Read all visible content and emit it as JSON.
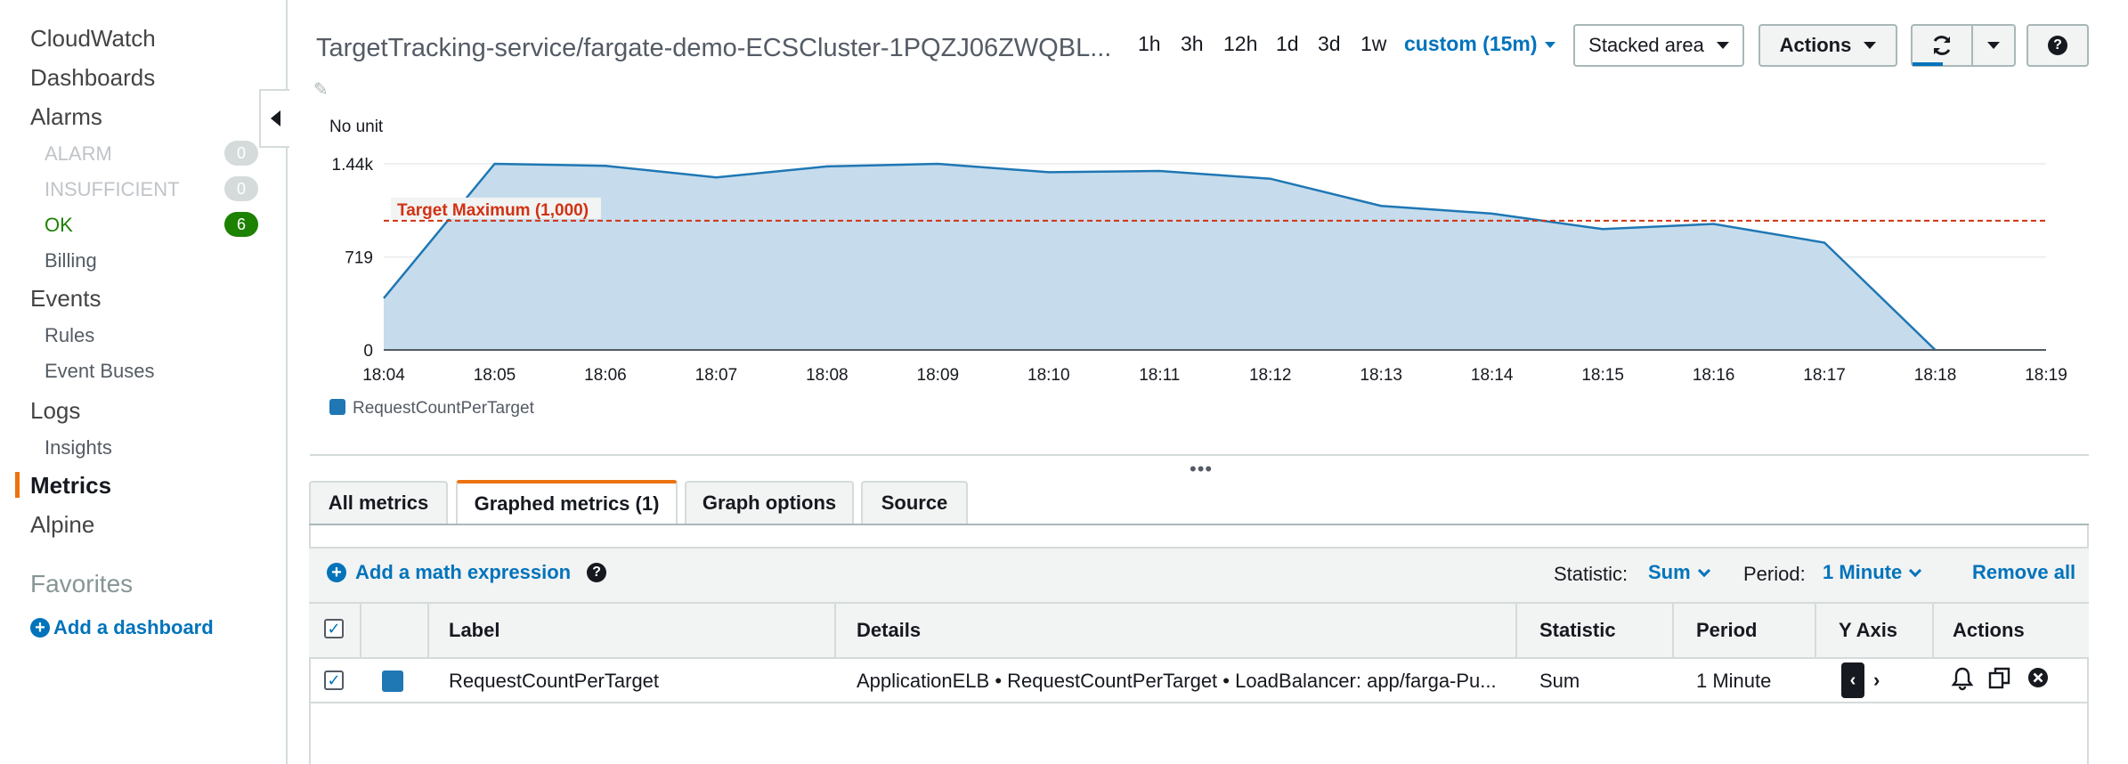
{
  "sidebar": {
    "cloudwatch": "CloudWatch",
    "dashboards": "Dashboards",
    "alarms": "Alarms",
    "alarm_states": [
      {
        "label": "ALARM",
        "count": "0"
      },
      {
        "label": "INSUFFICIENT",
        "count": "0"
      },
      {
        "label": "OK",
        "count": "6"
      }
    ],
    "billing": "Billing",
    "events": "Events",
    "rules": "Rules",
    "event_buses": "Event Buses",
    "logs": "Logs",
    "insights": "Insights",
    "metrics": "Metrics",
    "alpine": "Alpine",
    "favorites": "Favorites",
    "add_dashboard": "Add a dashboard"
  },
  "header": {
    "title": "TargetTracking-service/fargate-demo-ECSCluster-1PQZJ06ZWQBL...",
    "ranges": [
      "1h",
      "3h",
      "12h",
      "1d",
      "3d",
      "1w"
    ],
    "custom_range": "custom (15m)",
    "chart_type": "Stacked area",
    "actions": "Actions"
  },
  "chart_data": {
    "type": "area",
    "unit_label": "No unit",
    "x": [
      "18:04",
      "18:05",
      "18:06",
      "18:07",
      "18:08",
      "18:09",
      "18:10",
      "18:11",
      "18:12",
      "18:13",
      "18:14",
      "18:15",
      "18:16",
      "18:17",
      "18:18",
      "18:19"
    ],
    "series": [
      {
        "name": "RequestCountPerTarget",
        "color": "#1f77b4",
        "values": [
          400,
          1440,
          1425,
          1335,
          1420,
          1440,
          1375,
          1385,
          1325,
          1115,
          1055,
          935,
          975,
          830,
          0,
          null
        ]
      }
    ],
    "yticks": [
      "0",
      "719",
      "1.44k"
    ],
    "ylim": [
      0,
      1440
    ],
    "threshold": {
      "label": "Target Maximum (1,000)",
      "value": 1000,
      "color": "#d13212"
    },
    "legend": "bottom-left"
  },
  "tabs": [
    "All metrics",
    "Graphed metrics (1)",
    "Graph options",
    "Source"
  ],
  "toolbar": {
    "add_math": "Add a math expression",
    "statistic_label": "Statistic:",
    "statistic_value": "Sum",
    "period_label": "Period:",
    "period_value": "1 Minute",
    "remove_all": "Remove all"
  },
  "table": {
    "columns": [
      "Label",
      "Details",
      "Statistic",
      "Period",
      "Y Axis",
      "Actions"
    ],
    "rows": [
      {
        "label": "RequestCountPerTarget",
        "details": "ApplicationELB • RequestCountPerTarget • LoadBalancer: app/farga-Pu...",
        "statistic": "Sum",
        "period": "1 Minute"
      }
    ]
  }
}
